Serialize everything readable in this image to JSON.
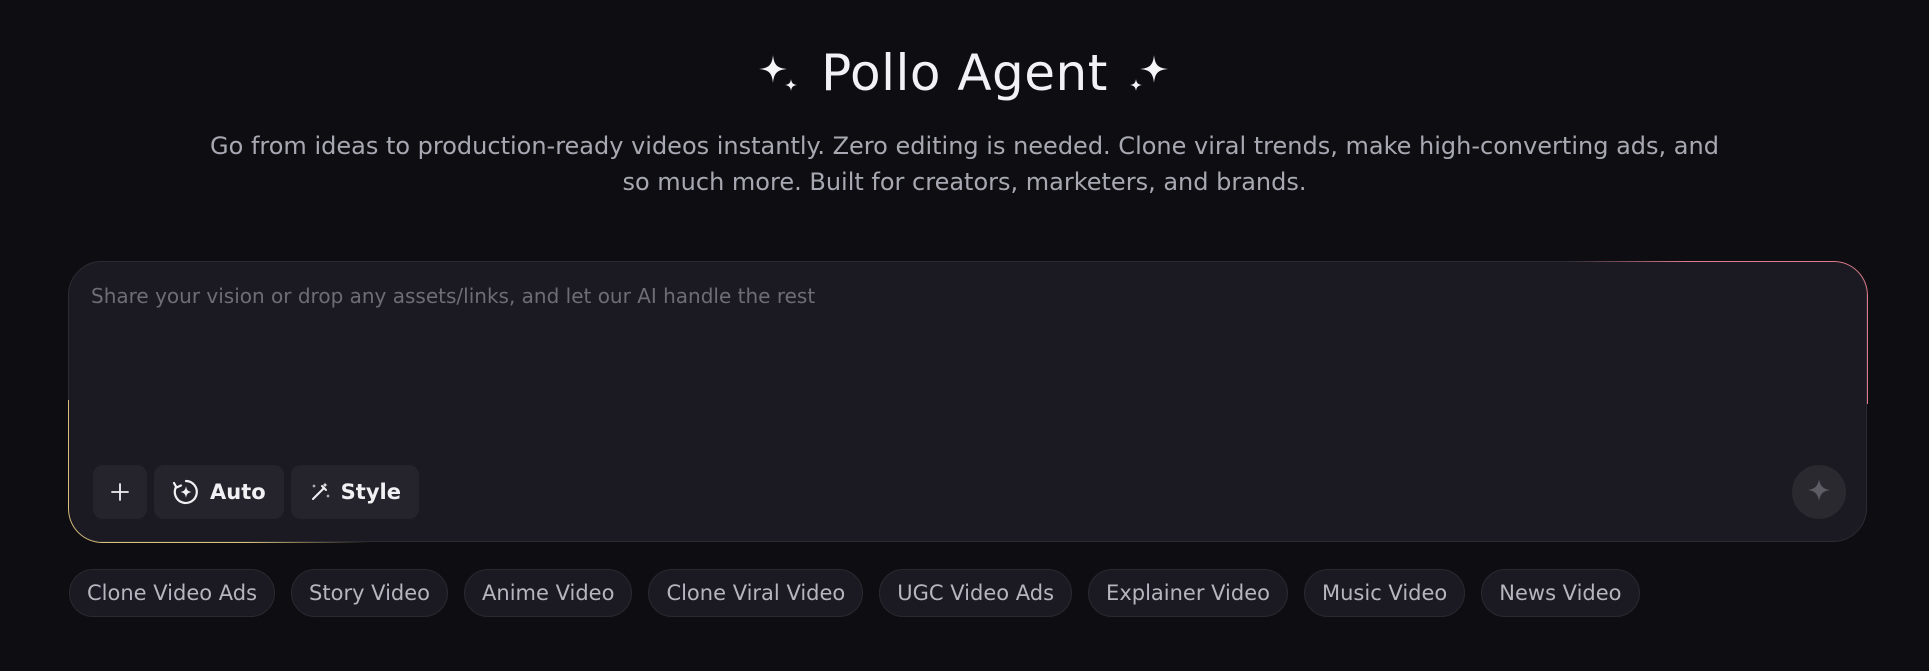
{
  "header": {
    "title": "Pollo Agent",
    "subtitle": "Go from ideas to production-ready videos instantly. Zero editing is needed. Clone viral trends, make high-converting ads, and so much more. Built for creators, marketers, and brands.",
    "left_icon": "sparkle-icon",
    "right_icon": "sparkle-icon"
  },
  "prompt": {
    "value": "",
    "placeholder": "Share your vision or drop any assets/links, and let our AI handle the rest"
  },
  "toolbar": {
    "add_icon": "plus-icon",
    "auto_label": "Auto",
    "auto_icon": "auto-mode-icon",
    "style_label": "Style",
    "style_icon": "magic-wand-icon",
    "send_icon": "sparkle-icon"
  },
  "chips": [
    "Clone Video Ads",
    "Story Video",
    "Anime Video",
    "Clone Viral Video",
    "UGC Video Ads",
    "Explainer Video",
    "Music Video",
    "News Video"
  ],
  "colors": {
    "background": "#0e0e12",
    "panel": "#1b1a22",
    "glow_warm": "#e07a8c",
    "glow_gold": "#d8c07a"
  }
}
